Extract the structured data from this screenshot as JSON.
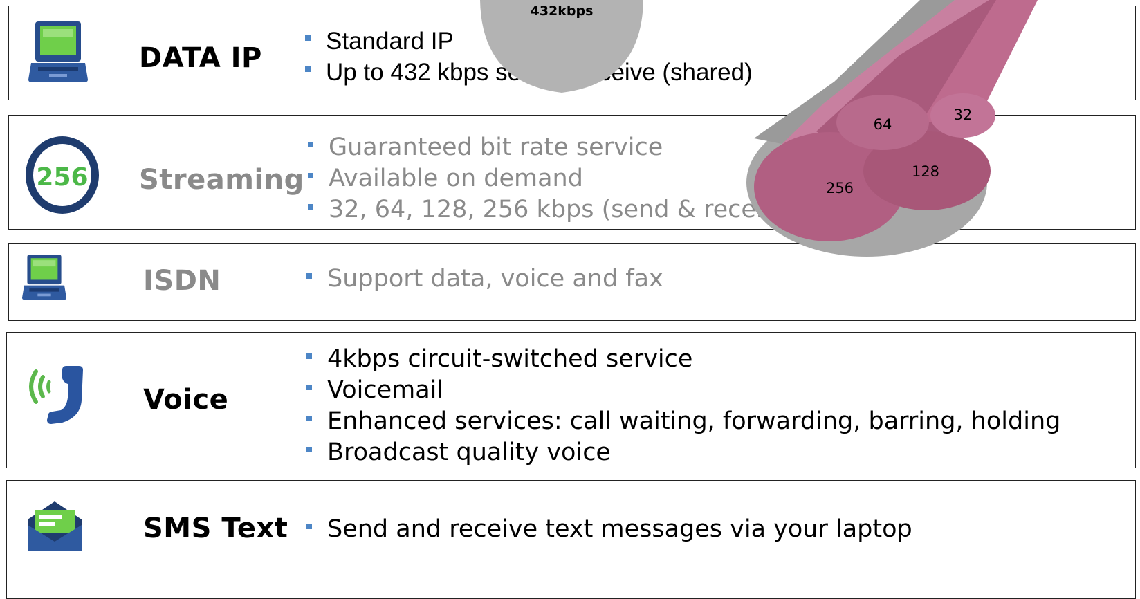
{
  "rows": [
    {
      "name": "DATA IP",
      "bullets": [
        "Standard IP",
        "Up to 432 kbps send & receive (shared)"
      ]
    },
    {
      "name": "Streaming",
      "bullets": [
        "Guaranteed bit rate service",
        "Available on demand",
        "32, 64, 128, 256 kbps (send & receive)"
      ]
    },
    {
      "name": "ISDN",
      "bullets": [
        "Support data, voice and fax"
      ]
    },
    {
      "name": "Voice",
      "bullets": [
        "4kbps circuit-switched service",
        "Voicemail",
        "Enhanced services: call waiting, forwarding, barring, holding",
        "Broadcast quality voice"
      ]
    },
    {
      "name": "SMS Text",
      "bullets": [
        "Send and receive text messages via your laptop"
      ]
    }
  ],
  "icons": {
    "laptop": "laptop-icon",
    "badge": "256",
    "phone": "phone-icon",
    "mail": "envelope-icon"
  },
  "graphic": {
    "top_label": "432kbps",
    "circle_labels": [
      "64",
      "32",
      "256",
      "128"
    ]
  },
  "colors": {
    "accent": "#4d86c6",
    "cylinder": "#b4607f",
    "grey_text": "#8a8a8a"
  }
}
